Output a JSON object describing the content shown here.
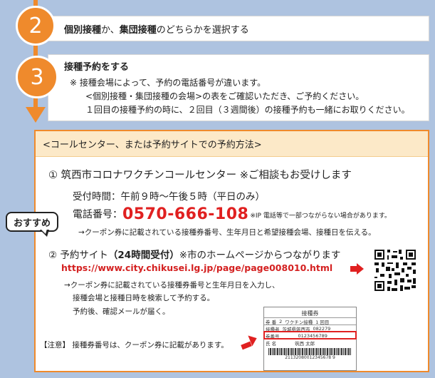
{
  "step2": {
    "number": "2",
    "text_bold": "個別接種",
    "text_mid": "か、",
    "text_bold2": "集団接種",
    "text_end": "のどちらかを選択する"
  },
  "step3": {
    "number": "3",
    "title": "接種予約をする",
    "note1": "※  接種会場によって、予約の電話番号が違います。",
    "note2": "<個別接種・集団接種の会場>の表をご確認いただき、ご予約ください。",
    "note3": "１回目の接種予約の時に、２回目（３週間後）の接種予約も一緒にお取りください。"
  },
  "panel": {
    "header": "<コールセンター、または予約サイトでの予約方法>",
    "call_center_title": "①  筑西市コロナワクチンコールセンター  ※ご相談もお受けします",
    "hours": "受付時間：午前９時～午後５時（平日のみ）",
    "phone_label": "電話番号：",
    "phone_number": "0570-666-108",
    "phone_note": "※IP 電話等で一部つながらない場合があります。",
    "phone_instruction": "→クーポン券に記載されている接種券番号、生年月日と希望接種会場、接種日を伝える。",
    "recommend_badge": "おすすめ",
    "site_title_prefix": "②  予約サイト",
    "site_title_bold": "（24時間受付）",
    "site_title_suffix": "※市のホームページからつながります",
    "site_url": "https://www.city.chikusei.lg.jp/page/page008010.html",
    "site_step1": "→クーポン券に記載されている接種券番号と生年月日を入力し、",
    "site_step2": "接種会場と接種日時を検索して予約する。",
    "site_step3": "予約後、確認メールが届く。",
    "caution": "【注意】 接種券番号は、クーポン券に記載があります。"
  },
  "ticket": {
    "title": "接種券",
    "r1": [
      "券  番",
      "2",
      "ワクチン接種",
      "1  回目"
    ],
    "r2": [
      "接種者",
      "茨城県筑西市",
      "082279"
    ],
    "r3": [
      "券番号",
      "0123456789"
    ],
    "r4": [
      "氏  名",
      "筑西  太郎"
    ],
    "barcode_number": "21132080012345678 9"
  },
  "colors": {
    "accent": "#ef8a2c",
    "background": "#aec3e0",
    "highlight": "#e02020"
  }
}
